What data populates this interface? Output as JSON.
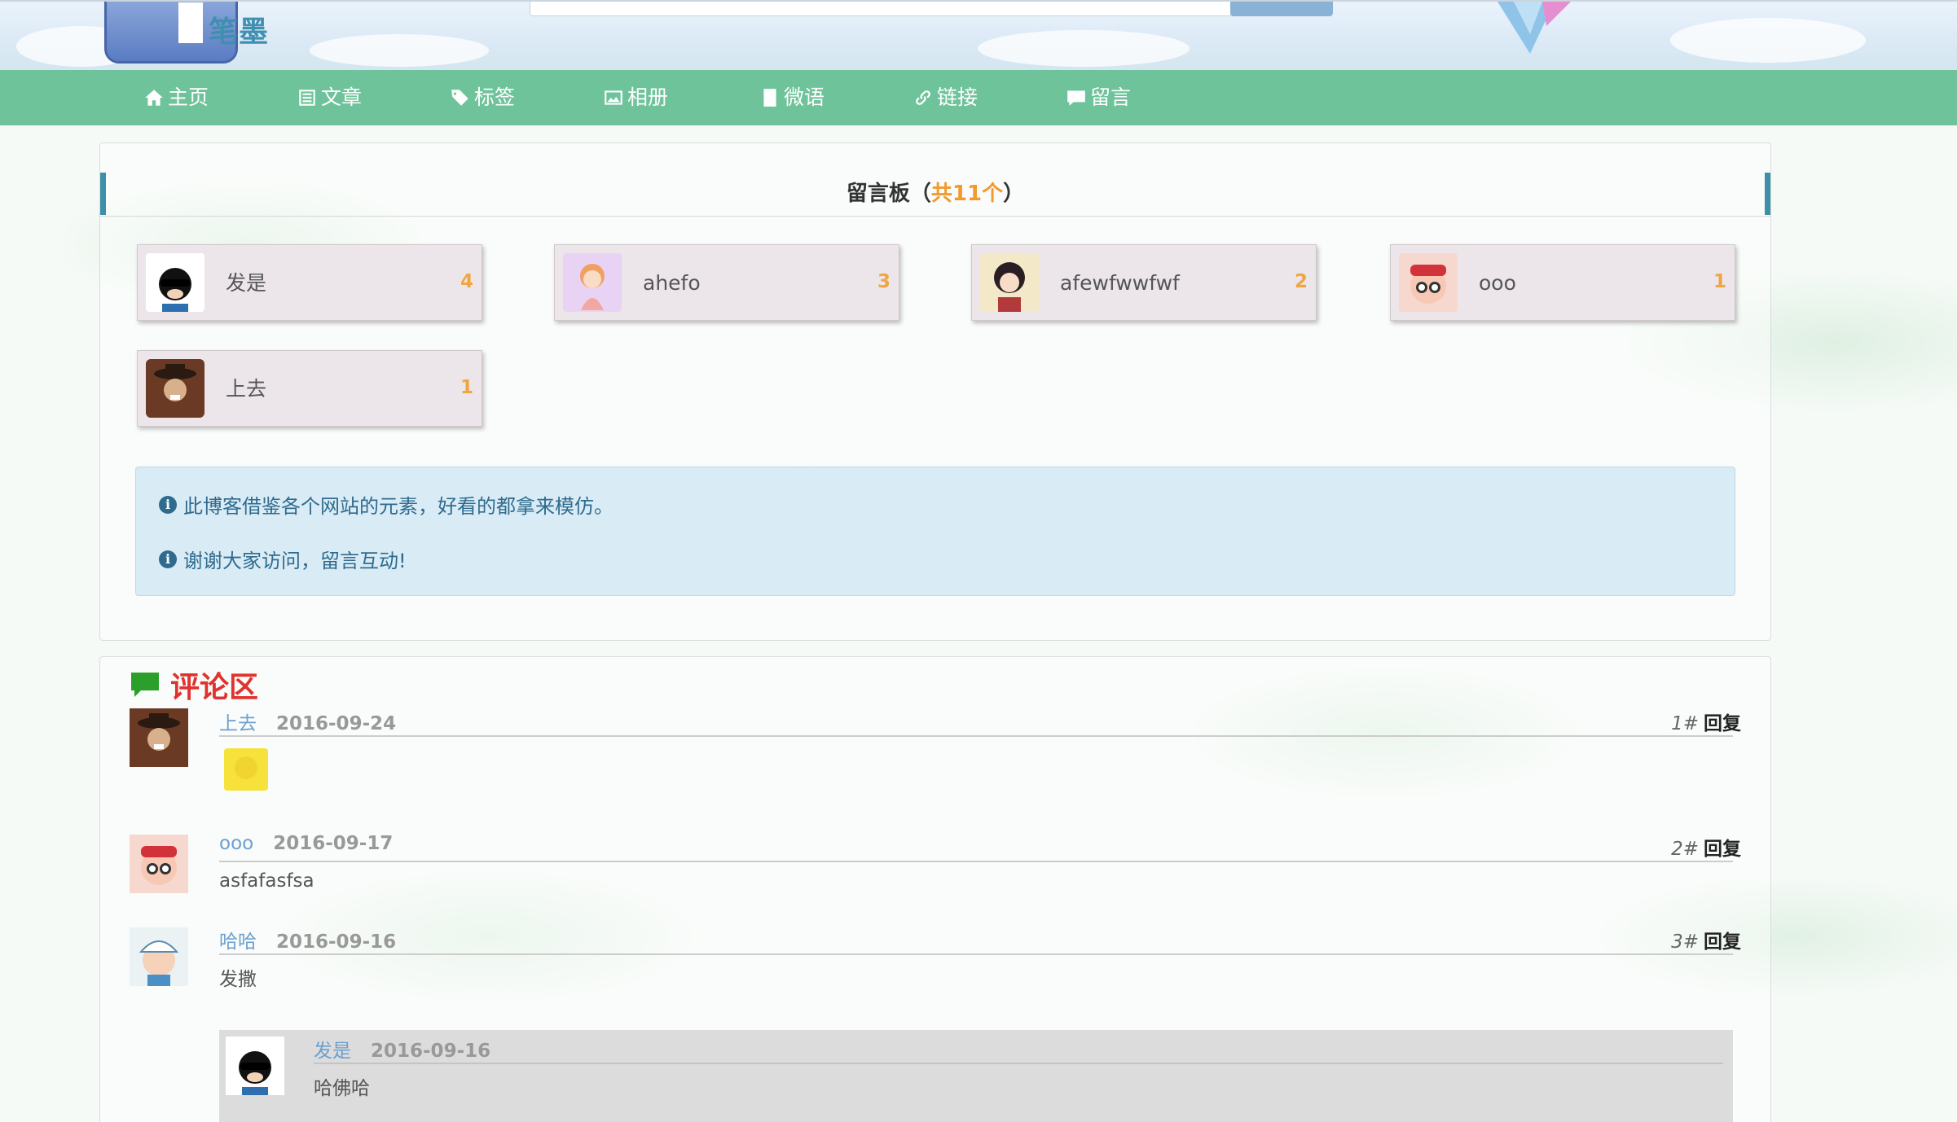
{
  "header": {
    "logo_text": "笔墨"
  },
  "nav": [
    {
      "label": "主页",
      "icon": "home-icon"
    },
    {
      "label": "文章",
      "icon": "list-icon"
    },
    {
      "label": "标签",
      "icon": "tags-icon"
    },
    {
      "label": "相册",
      "icon": "picture-icon"
    },
    {
      "label": "微语",
      "icon": "book-icon"
    },
    {
      "label": "链接",
      "icon": "link-icon"
    },
    {
      "label": "留言",
      "icon": "comment-icon"
    }
  ],
  "board": {
    "title_prefix": "留言板（",
    "count_text": "共11个",
    "title_suffix": "）",
    "users": [
      {
        "name": "发是",
        "count": "4"
      },
      {
        "name": "ahefo",
        "count": "3"
      },
      {
        "name": "afewfwwfwf",
        "count": "2"
      },
      {
        "name": "ooo",
        "count": "1"
      },
      {
        "name": "上去",
        "count": "1"
      }
    ],
    "notices": [
      "此博客借鉴各个网站的元素，好看的都拿来模仿。",
      "谢谢大家访问，留言互动!"
    ]
  },
  "comments": {
    "title": "评论区",
    "reply_label": "回复",
    "items": [
      {
        "user": "上去",
        "date": "2016-09-24",
        "floor": "1#",
        "text": ""
      },
      {
        "user": "ooo",
        "date": "2016-09-17",
        "floor": "2#",
        "text": "asfafasfsa"
      },
      {
        "user": "哈哈",
        "date": "2016-09-16",
        "floor": "3#",
        "text": "发撒"
      }
    ],
    "reply": {
      "user": "发是",
      "date": "2016-09-16",
      "text": "哈佛哈"
    }
  },
  "colors": {
    "nav_bg": "#6ec39a",
    "accent_orange": "#f29a2e",
    "comment_title_red": "#e0322f",
    "username_blue": "#6c9fd0"
  }
}
